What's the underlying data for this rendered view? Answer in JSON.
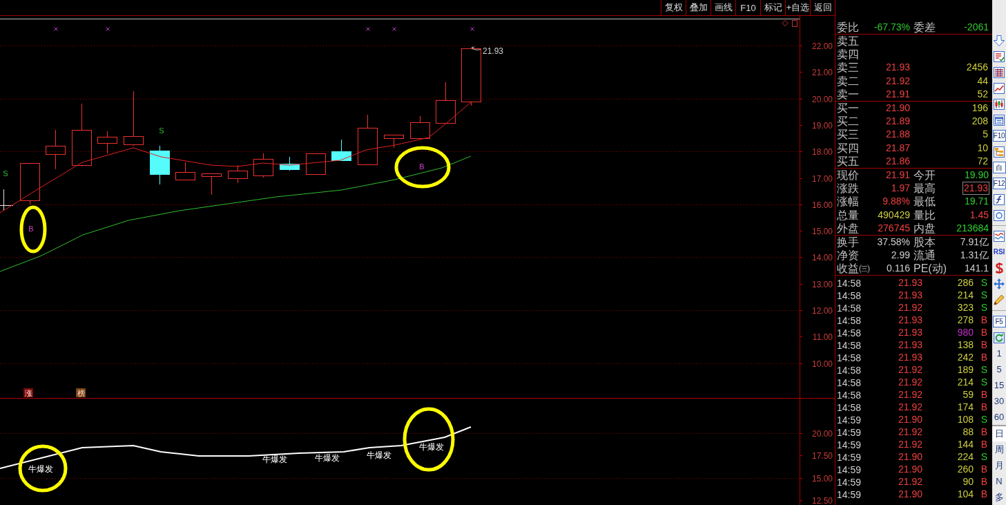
{
  "toolbar": {
    "buttons": [
      "复权",
      "叠加",
      "画线",
      "F10",
      "标记",
      "+自选",
      "返回"
    ]
  },
  "chart": {
    "price_axis": [
      "22.00",
      "21.00",
      "20.00",
      "19.00",
      "18.00",
      "17.00",
      "16.00",
      "15.00",
      "14.00",
      "13.00",
      "12.00",
      "11.00",
      "10.00"
    ],
    "last_price": "21.93",
    "signals": [
      {
        "text": "S",
        "kind": "sell"
      },
      {
        "text": "B",
        "kind": "buy"
      },
      {
        "text": "S",
        "kind": "sell"
      },
      {
        "text": "B",
        "kind": "buy"
      }
    ],
    "tags": [
      {
        "text": "涨",
        "color": "#7c0a0a"
      },
      {
        "text": "榜",
        "color": "#7a4412"
      }
    ]
  },
  "indicator": {
    "axis": [
      "20.00",
      "17.50",
      "15.00",
      "12.50"
    ],
    "labels": [
      "牛爆发",
      "牛爆发",
      "牛爆发",
      "牛爆发",
      "牛爆发"
    ]
  },
  "quote": {
    "ratio": [
      {
        "label": "委比",
        "value": "-67.73%",
        "color": "#30c830"
      },
      {
        "label": "委差",
        "value": "-2061",
        "color": "#30c830"
      }
    ],
    "asks": [
      {
        "label": "卖五"
      },
      {
        "label": "卖四"
      },
      {
        "label": "卖三",
        "price": "21.93",
        "volume": "2456"
      },
      {
        "label": "卖二",
        "price": "21.92",
        "volume": "44"
      },
      {
        "label": "卖一",
        "price": "21.91",
        "volume": "52"
      }
    ],
    "bids": [
      {
        "label": "买一",
        "price": "21.90",
        "volume": "196"
      },
      {
        "label": "买二",
        "price": "21.89",
        "volume": "208"
      },
      {
        "label": "买三",
        "price": "21.88",
        "volume": "5"
      },
      {
        "label": "买四",
        "price": "21.87",
        "volume": "10"
      },
      {
        "label": "买五",
        "price": "21.86",
        "volume": "72"
      }
    ],
    "stats": [
      {
        "label": "现价",
        "value": "21.91",
        "color": "#f04040",
        "boxed": false
      },
      {
        "label": "今开",
        "value": "19.90",
        "color": "#30d030",
        "boxed": false
      },
      {
        "label": "涨跌",
        "value": "1.97",
        "color": "#f04040",
        "boxed": false
      },
      {
        "label": "最高",
        "value": "21.93",
        "color": "#f04040",
        "boxed": true
      },
      {
        "label": "涨幅",
        "value": "9.88%",
        "color": "#f04040",
        "boxed": false
      },
      {
        "label": "最低",
        "value": "19.71",
        "color": "#30d030",
        "boxed": false
      },
      {
        "label": "总量",
        "value": "490429",
        "color": "#d0d040",
        "boxed": false
      },
      {
        "label": "量比",
        "value": "1.45",
        "color": "#f04040",
        "boxed": false
      },
      {
        "label": "外盘",
        "value": "276745",
        "color": "#f04040",
        "boxed": false
      },
      {
        "label": "内盘",
        "value": "213684",
        "color": "#30d030",
        "boxed": false
      }
    ],
    "fundamentals": [
      {
        "label": "换手",
        "value": "37.58%"
      },
      {
        "label": "股本",
        "value": "7.91亿"
      },
      {
        "label": "净资",
        "value": "2.99"
      },
      {
        "label": "流通",
        "value": "1.31亿"
      },
      {
        "label": "收益㈢",
        "value": "0.116"
      },
      {
        "label": "PE(动)",
        "value": "141.1"
      }
    ],
    "ticks": [
      {
        "time": "14:58",
        "price": "21.93",
        "volume": "286",
        "color": "#d0d040",
        "side": "S",
        "kind": "sell"
      },
      {
        "time": "14:58",
        "price": "21.93",
        "volume": "214",
        "color": "#d0d040",
        "side": "S",
        "kind": "sell"
      },
      {
        "time": "14:58",
        "price": "21.92",
        "volume": "323",
        "color": "#d0d040",
        "side": "S",
        "kind": "sell"
      },
      {
        "time": "14:58",
        "price": "21.93",
        "volume": "278",
        "color": "#d0d040",
        "side": "B",
        "kind": "buy"
      },
      {
        "time": "14:58",
        "price": "21.93",
        "volume": "980",
        "color": "#c030c8",
        "side": "B",
        "kind": "buy"
      },
      {
        "time": "14:58",
        "price": "21.93",
        "volume": "138",
        "color": "#d0d040",
        "side": "B",
        "kind": "buy"
      },
      {
        "time": "14:58",
        "price": "21.93",
        "volume": "242",
        "color": "#d0d040",
        "side": "B",
        "kind": "buy"
      },
      {
        "time": "14:58",
        "price": "21.92",
        "volume": "189",
        "color": "#d0d040",
        "side": "S",
        "kind": "sell"
      },
      {
        "time": "14:58",
        "price": "21.92",
        "volume": "214",
        "color": "#d0d040",
        "side": "S",
        "kind": "sell"
      },
      {
        "time": "14:58",
        "price": "21.92",
        "volume": "59",
        "color": "#d0d040",
        "side": "B",
        "kind": "buy"
      },
      {
        "time": "14:58",
        "price": "21.92",
        "volume": "174",
        "color": "#d0d040",
        "side": "B",
        "kind": "buy"
      },
      {
        "time": "14:59",
        "price": "21.90",
        "volume": "108",
        "color": "#d0d040",
        "side": "S",
        "kind": "sell"
      },
      {
        "time": "14:59",
        "price": "21.92",
        "volume": "88",
        "color": "#d0d040",
        "side": "B",
        "kind": "buy"
      },
      {
        "time": "14:59",
        "price": "21.92",
        "volume": "144",
        "color": "#d0d040",
        "side": "B",
        "kind": "buy"
      },
      {
        "time": "14:59",
        "price": "21.90",
        "volume": "224",
        "color": "#d0d040",
        "side": "S",
        "kind": "sell"
      },
      {
        "time": "14:59",
        "price": "21.90",
        "volume": "260",
        "color": "#d0d040",
        "side": "B",
        "kind": "buy"
      },
      {
        "time": "14:59",
        "price": "21.92",
        "volume": "90",
        "color": "#d0d040",
        "side": "B",
        "kind": "buy"
      },
      {
        "time": "14:59",
        "price": "21.90",
        "volume": "104",
        "color": "#d0d040",
        "side": "B",
        "kind": "buy"
      }
    ]
  },
  "side_toolbar": [
    [
      {
        "kind": "icon"
      },
      {
        "kind": "icon"
      },
      {
        "kind": "icon"
      },
      {
        "kind": "icon"
      },
      {
        "kind": "icon"
      },
      {
        "kind": "icon"
      },
      {
        "kind": "key",
        "label": "F10"
      },
      {
        "kind": "icon"
      },
      {
        "kind": "key",
        "label": "自"
      },
      {
        "kind": "key",
        "label": "F12"
      },
      {
        "kind": "icon"
      },
      {
        "kind": "icon"
      }
    ],
    [
      {
        "kind": "icon"
      },
      {
        "kind": "text",
        "label": "RSI"
      },
      {
        "kind": "icon"
      },
      {
        "kind": "icon"
      },
      {
        "kind": "icon"
      }
    ],
    [
      {
        "kind": "key",
        "label": "F5"
      },
      {
        "kind": "icon"
      },
      {
        "kind": "period",
        "label": "1",
        "selected": false
      },
      {
        "kind": "period",
        "label": "5",
        "selected": false
      },
      {
        "kind": "period",
        "label": "15",
        "selected": false
      },
      {
        "kind": "period",
        "label": "30",
        "selected": false
      },
      {
        "kind": "period",
        "label": "60",
        "selected": false
      }
    ],
    [
      {
        "kind": "period",
        "label": "日",
        "selected": true
      },
      {
        "kind": "period",
        "label": "周",
        "selected": false
      },
      {
        "kind": "period",
        "label": "月",
        "selected": false
      },
      {
        "kind": "period",
        "label": "N",
        "selected": false
      },
      {
        "kind": "period",
        "label": "多",
        "selected": false
      }
    ]
  ]
}
